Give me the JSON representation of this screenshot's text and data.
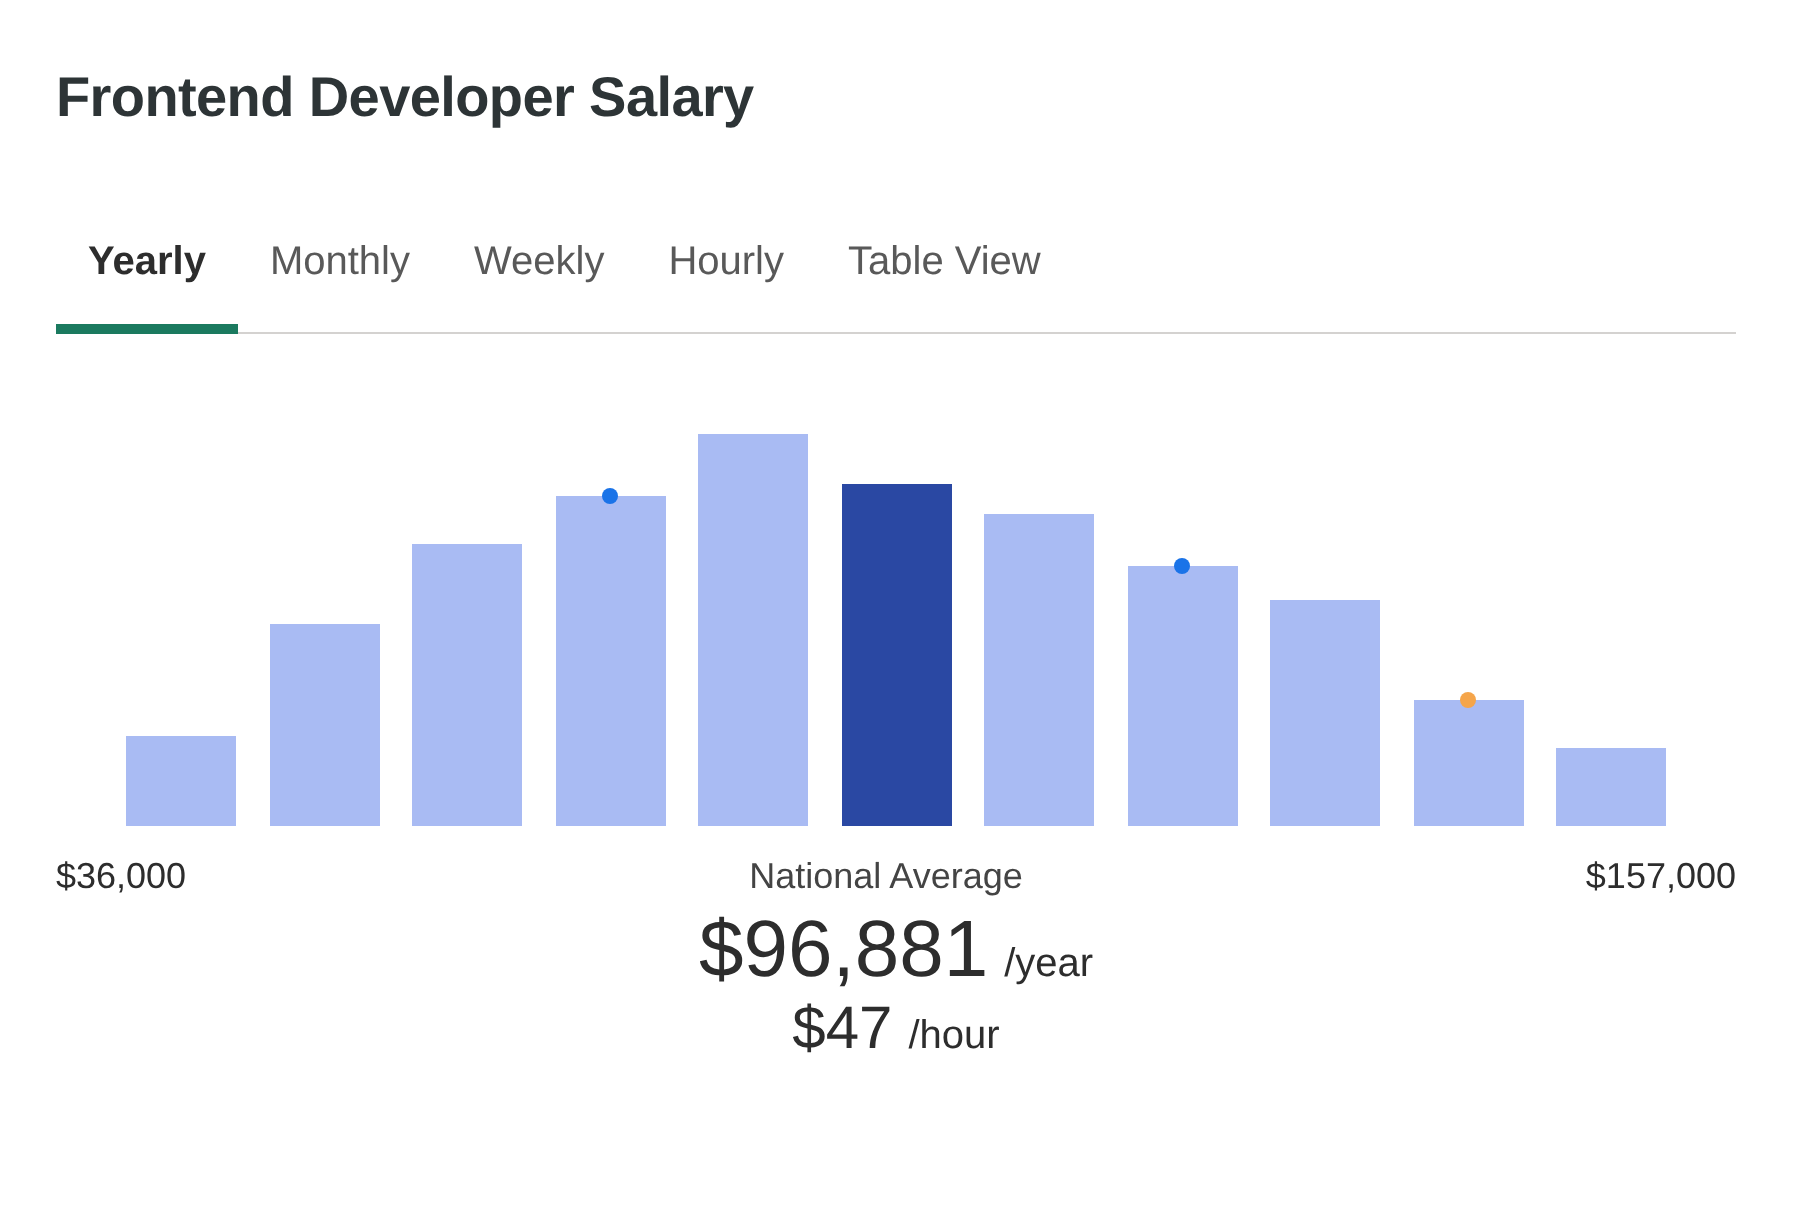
{
  "title": "Frontend Developer Salary",
  "tabs": [
    {
      "label": "Yearly",
      "selected": true
    },
    {
      "label": "Monthly",
      "selected": false
    },
    {
      "label": "Weekly",
      "selected": false
    },
    {
      "label": "Hourly",
      "selected": false
    },
    {
      "label": "Table View",
      "selected": false
    }
  ],
  "histogram": {
    "bars": [
      {
        "selected": false
      },
      {
        "selected": false
      },
      {
        "selected": false
      },
      {
        "selected": false,
        "color": "#1a73e8"
      },
      {
        "selected": false
      },
      {
        "selected": true
      },
      {
        "selected": false
      },
      {
        "selected": false,
        "color": "#1a73e8"
      },
      {
        "selected": false
      },
      {
        "selected": false,
        "color": "#f5a54a"
      },
      {
        "selected": false
      }
    ],
    "min_label": "$36,000",
    "center_label": "National Average",
    "max_label": "$157,000"
  },
  "salary": {
    "yearly_amount": "$96,881",
    "yearly_unit": "/year",
    "hourly_amount": "$47",
    "hourly_unit": "/hour"
  }
}
